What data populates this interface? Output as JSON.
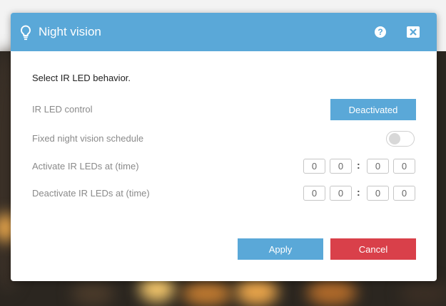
{
  "dialog": {
    "title": "Night vision",
    "title_icon": "lightbulb-icon",
    "help_icon": "question-circle-icon",
    "help_glyph": "?",
    "close_icon": "close-x-icon"
  },
  "content": {
    "intro": "Select IR LED behavior.",
    "ir_led_control": {
      "label": "IR LED control",
      "button_label": "Deactivated"
    },
    "schedule": {
      "label": "Fixed night vision schedule",
      "enabled": false
    },
    "activate": {
      "label": "Activate IR LEDs at (time)",
      "digits": [
        "0",
        "0",
        "0",
        "0"
      ],
      "separator": ":"
    },
    "deactivate": {
      "label": "Deactivate IR LEDs at (time)",
      "digits": [
        "0",
        "0",
        "0",
        "0"
      ],
      "separator": ":"
    }
  },
  "footer": {
    "apply_label": "Apply",
    "cancel_label": "Cancel"
  },
  "colors": {
    "accent": "#5aa8d8",
    "danger": "#d9404a"
  }
}
